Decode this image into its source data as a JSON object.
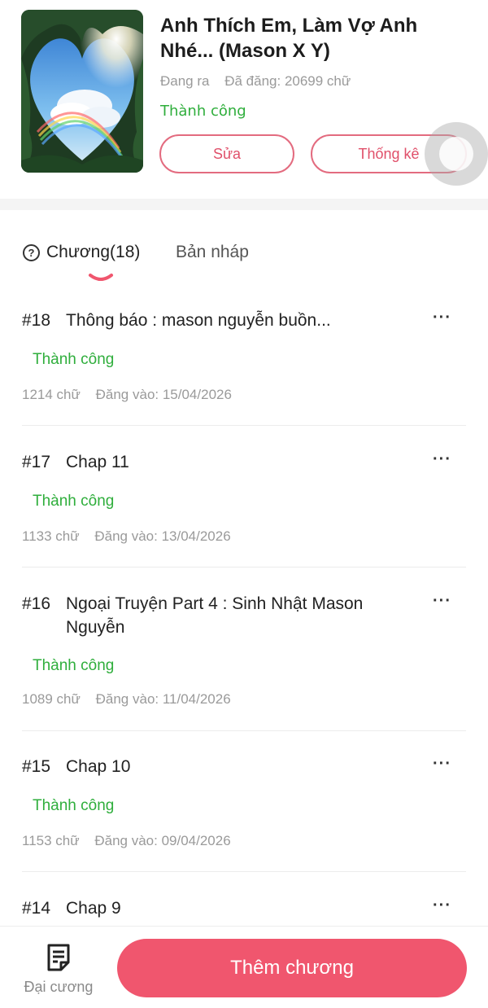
{
  "book": {
    "title": "Anh Thích Em, Làm Vợ Anh Nhé... (Mason X Y)",
    "state": "Đang ra",
    "word_count": "Đã đăng: 20699 chữ",
    "status": "Thành công",
    "edit_label": "Sửa",
    "stats_label": "Thống kê"
  },
  "tabs": {
    "chapters_label": "Chương(18)",
    "drafts_label": "Bản nháp",
    "help_icon": "?"
  },
  "chapters": [
    {
      "num": "#18",
      "title": "Thông báo : mason nguyễn buồn...",
      "status": "Thành công",
      "words": "1214 chữ",
      "posted": "Đăng vào:  15/04/2026",
      "more": "···"
    },
    {
      "num": "#17",
      "title": "Chap 11",
      "status": "Thành công",
      "words": "1133 chữ",
      "posted": "Đăng vào:  13/04/2026",
      "more": "···"
    },
    {
      "num": "#16",
      "title": "Ngoại Truyện Part 4 : Sinh Nhật Mason Nguyễn",
      "status": "Thành công",
      "words": "1089 chữ",
      "posted": "Đăng vào:  11/04/2026",
      "more": "···"
    },
    {
      "num": "#15",
      "title": "Chap 10",
      "status": "Thành công",
      "words": "1153 chữ",
      "posted": "Đăng vào:  09/04/2026",
      "more": "···"
    },
    {
      "num": "#14",
      "title": "Chap 9",
      "more": "···"
    }
  ],
  "bottom": {
    "outline_label": "Đại cương",
    "add_chapter_label": "Thêm chương"
  },
  "colors": {
    "accent": "#f0566e",
    "success": "#2fae3c",
    "muted": "#9a9a9a"
  }
}
